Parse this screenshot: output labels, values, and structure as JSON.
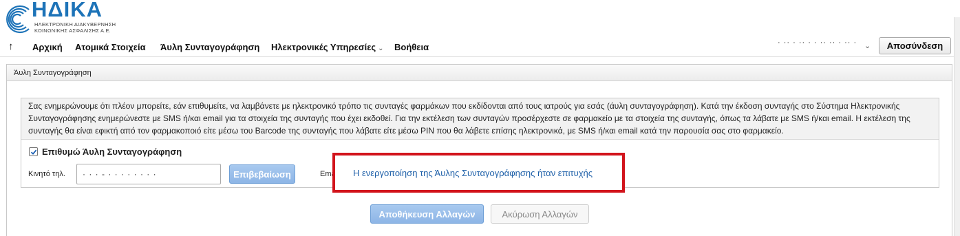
{
  "brand": {
    "title": "ΗΔΙΚΑ",
    "subtitle": "ΗΛΕΚΤΡΟΝΙΚΗ ΔΙΑΚΥΒΕΡΝΗΣΗ\nΚΟΙΝΩΝΙΚΗΣ ΑΣΦΑΛΙΣΗΣ Α.Ε.",
    "color": "#1d73b8"
  },
  "nav": {
    "up_icon": "↑",
    "items": [
      {
        "label": "Αρχική"
      },
      {
        "label": "Ατομικά Στοιχεία"
      },
      {
        "label": "Άυλη Συνταγογράφηση"
      },
      {
        "label": "Ηλεκτρονικές Υπηρεσίες"
      },
      {
        "label": "Βοήθεια"
      }
    ]
  },
  "user": {
    "name_masked": "· ·· · ·· · · ·· ·· · ·· · ·",
    "logout_label": "Αποσύνδεση"
  },
  "panel": {
    "title": "Άυλη Συνταγογράφηση",
    "notice": "Σας ενημερώνουμε ότι πλέον μπορείτε, εάν επιθυμείτε, να λαμβάνετε με ηλεκτρονικό τρόπο τις συνταγές φαρμάκων που εκδίδονται από τους ιατρούς για εσάς (άυλη συνταγογράφηση). Κατά την έκδοση συνταγής στο Σύστημα Ηλεκτρονικής Συνταγογράφησης ενημερώνεστε με SMS ή/και email για τα στοιχεία της συνταγής που έχει εκδοθεί. Για την εκτέλεση των συνταγών προσέρχεστε σε φαρμακείο με τα στοιχεία της συνταγής, όπως τα λάβατε με SMS ή/και email. Η εκτέλεση της συνταγής θα είναι εφικτή από τον φαρμακοποιό είτε μέσω του Barcode της συνταγής που λάβατε είτε μέσω PIN που θα λάβετε επίσης ηλεκτρονικά, με SMS ή/και email κατά την παρουσία σας στο φαρμακείο.",
    "checkbox_label": "Επιθυμώ Άυλη Συνταγογράφηση",
    "checkbox_checked": true,
    "phone_label": "Κινητό τηλ.",
    "phone_value": "· · · - · · · · · · · ·",
    "confirm_label": "Επιβεβαίωση",
    "email_label": "Email",
    "success_message": "Η ενεργοποίηση της Άυλης Συνταγογράφησης ήταν επιτυχής",
    "save_label": "Αποθήκευση Αλλαγών",
    "cancel_label": "Ακύρωση Αλλαγών"
  },
  "colors": {
    "accent": "#8db5e6",
    "highlight_border": "#d2141c",
    "link": "#1d5fa8"
  }
}
